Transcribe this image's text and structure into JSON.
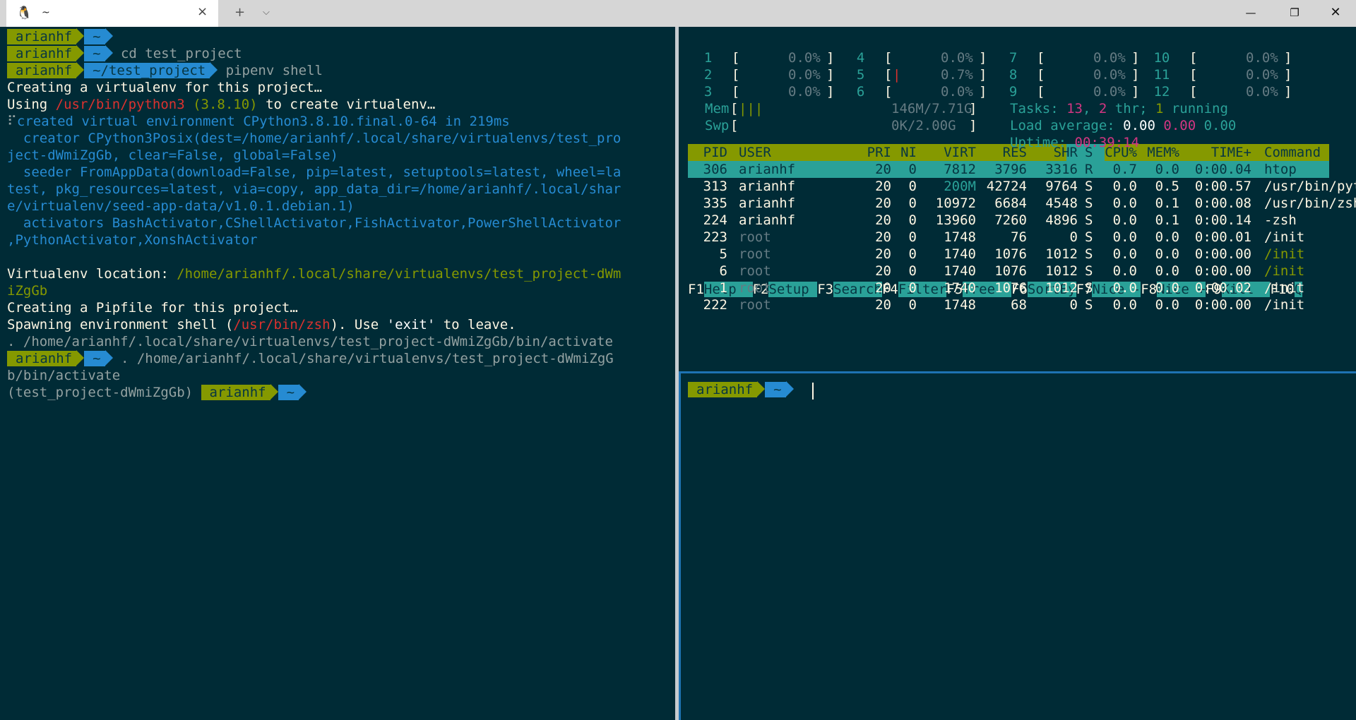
{
  "window": {
    "tab_title": "~",
    "tab_icon": "tux-penguin-icon"
  },
  "left": {
    "lines": [
      {
        "t": "prompt",
        "user": "arianhf",
        "dir": "~",
        "cmd": ""
      },
      {
        "t": "prompt",
        "user": "arianhf",
        "dir": "~",
        "cmd": "cd test_project"
      },
      {
        "t": "prompt",
        "user": "arianhf",
        "dir": "~/test_project",
        "cmd": "pipenv shell"
      },
      {
        "t": "text",
        "segs": [
          [
            "Creating a virtualenv for this project…",
            "wh"
          ]
        ]
      },
      {
        "t": "text",
        "segs": [
          [
            "Using ",
            "wh"
          ],
          [
            "/usr/bin/python3",
            "red"
          ],
          [
            " (3.8.10)",
            "olive"
          ],
          [
            " to create virtualenv…",
            "wh"
          ]
        ]
      },
      {
        "t": "text",
        "segs": [
          [
            "⠏",
            "gray"
          ],
          [
            "created virtual environment CPython3.8.10.final.0-64 in 219ms",
            "blue"
          ]
        ]
      },
      {
        "t": "text",
        "segs": [
          [
            "  creator CPython3Posix(dest=/home/arianhf/.local/share/virtualenvs/test_pro",
            "blue"
          ]
        ]
      },
      {
        "t": "text",
        "segs": [
          [
            "ject-dWmiZgGb, clear=False, global=False)",
            "blue"
          ]
        ]
      },
      {
        "t": "text",
        "segs": [
          [
            "  seeder FromAppData(download=False, pip=latest, setuptools=latest, wheel=la",
            "blue"
          ]
        ]
      },
      {
        "t": "text",
        "segs": [
          [
            "test, pkg_resources=latest, via=copy, app_data_dir=/home/arianhf/.local/shar",
            "blue"
          ]
        ]
      },
      {
        "t": "text",
        "segs": [
          [
            "e/virtualenv/seed-app-data/v1.0.1.debian.1)",
            "blue"
          ]
        ]
      },
      {
        "t": "text",
        "segs": [
          [
            "  activators BashActivator,CShellActivator,FishActivator,PowerShellActivator",
            "blue"
          ]
        ]
      },
      {
        "t": "text",
        "segs": [
          [
            ",PythonActivator,XonshActivator",
            "blue"
          ]
        ]
      },
      {
        "t": "text",
        "segs": [
          [
            "",
            "wh"
          ]
        ]
      },
      {
        "t": "text",
        "segs": [
          [
            "Virtualenv location: ",
            "wh"
          ],
          [
            "/home/arianhf/.local/share/virtualenvs/test_project-dWm",
            "olive"
          ]
        ]
      },
      {
        "t": "text",
        "segs": [
          [
            "iZgGb",
            "olive"
          ]
        ]
      },
      {
        "t": "text",
        "segs": [
          [
            "Creating a Pipfile for this project…",
            "wh"
          ]
        ]
      },
      {
        "t": "text",
        "segs": [
          [
            "Spawning environment shell (",
            "wh"
          ],
          [
            "/usr/bin/zsh",
            "red"
          ],
          [
            "). Use ",
            "wh"
          ],
          [
            "'exit'",
            "bright"
          ],
          [
            " to leave.",
            "wh"
          ]
        ]
      },
      {
        "t": "text",
        "segs": [
          [
            ". /home/arianhf/.local/share/virtualenvs/test_project-dWmiZgGb/bin/activate",
            "gray"
          ]
        ]
      },
      {
        "t": "prompt",
        "user": "arianhf",
        "dir": "~",
        "cmd": ". /home/arianhf/.local/share/virtualenvs/test_project-dWmiZgG"
      },
      {
        "t": "text",
        "segs": [
          [
            "b/bin/activate",
            "gray"
          ]
        ]
      },
      {
        "t": "venvprompt",
        "venv": "(test_project-dWmiZgGb)",
        "user": "arianhf",
        "dir": "~"
      }
    ]
  },
  "htop": {
    "cpus": [
      {
        "n": "1",
        "bar": "",
        "pct": "0.0%"
      },
      {
        "n": "2",
        "bar": "",
        "pct": "0.0%"
      },
      {
        "n": "3",
        "bar": "",
        "pct": "0.0%"
      },
      {
        "n": "4",
        "bar": "",
        "pct": "0.0%"
      },
      {
        "n": "5",
        "bar": "|",
        "pct": "0.7%"
      },
      {
        "n": "6",
        "bar": "",
        "pct": "0.0%"
      },
      {
        "n": "7",
        "bar": "",
        "pct": "0.0%"
      },
      {
        "n": "8",
        "bar": "",
        "pct": "0.0%"
      },
      {
        "n": "9",
        "bar": "",
        "pct": "0.0%"
      },
      {
        "n": "10",
        "bar": "",
        "pct": "0.0%"
      },
      {
        "n": "11",
        "bar": "",
        "pct": "0.0%"
      },
      {
        "n": "12",
        "bar": "",
        "pct": "0.0%"
      }
    ],
    "mem": {
      "label": "Mem",
      "bar": "|||",
      "value": "146M/7.71G"
    },
    "swp": {
      "label": "Swp",
      "bar": "",
      "value": "0K/2.00G"
    },
    "tasks": {
      "label": "Tasks: ",
      "count": "13",
      "sep1": ", ",
      "thr": "2",
      "thr_label": " thr; ",
      "running": "1",
      "running_label": " running"
    },
    "load": {
      "label": "Load average: ",
      "v1": "0.00",
      "v2": "0.00",
      "v3": "0.00"
    },
    "uptime": {
      "label": "Uptime: ",
      "value": "00:39:14"
    },
    "columns": [
      "PID",
      "USER",
      "PRI",
      "NI",
      "VIRT",
      "RES",
      "SHR",
      "S",
      "CPU%",
      "MEM%",
      "TIME+",
      "Command"
    ],
    "processes": [
      [
        "306",
        "arianhf",
        "20",
        "0",
        "7812",
        "3796",
        "3316",
        "R",
        "0.7",
        "0.0",
        "0:00.04",
        "htop"
      ],
      [
        "313",
        "arianhf",
        "20",
        "0",
        "200M",
        "42724",
        "9764",
        "S",
        "0.0",
        "0.5",
        "0:00.57",
        "/usr/bin/pyth"
      ],
      [
        "335",
        "arianhf",
        "20",
        "0",
        "10972",
        "6684",
        "4548",
        "S",
        "0.0",
        "0.1",
        "0:00.08",
        "/usr/bin/zsh"
      ],
      [
        "224",
        "arianhf",
        "20",
        "0",
        "13960",
        "7260",
        "4896",
        "S",
        "0.0",
        "0.1",
        "0:00.14",
        "-zsh"
      ],
      [
        "223",
        "root",
        "20",
        "0",
        "1748",
        "76",
        "0",
        "S",
        "0.0",
        "0.0",
        "0:00.01",
        "/init"
      ],
      [
        "5",
        "root",
        "20",
        "0",
        "1740",
        "1076",
        "1012",
        "S",
        "0.0",
        "0.0",
        "0:00.00",
        "/init"
      ],
      [
        "6",
        "root",
        "20",
        "0",
        "1740",
        "1076",
        "1012",
        "S",
        "0.0",
        "0.0",
        "0:00.00",
        "/init"
      ],
      [
        "1",
        "root",
        "20",
        "0",
        "1740",
        "1076",
        "1012",
        "S",
        "0.0",
        "0.0",
        "0:00.02",
        "/init"
      ],
      [
        "222",
        "root",
        "20",
        "0",
        "1748",
        "68",
        "0",
        "S",
        "0.0",
        "0.0",
        "0:00.00",
        "/init"
      ]
    ],
    "fkeys": [
      [
        "F1",
        "Help  "
      ],
      [
        "F2",
        "Setup "
      ],
      [
        "F3",
        "Search"
      ],
      [
        "F4",
        "Filter"
      ],
      [
        "F5",
        "Tree  "
      ],
      [
        "F6",
        "SortBy"
      ],
      [
        "F7",
        "Nice -"
      ],
      [
        "F8",
        "Nice +"
      ],
      [
        "F9",
        "Kill  "
      ],
      [
        "F10",
        "Q"
      ]
    ]
  },
  "bottom": {
    "user": "arianhf",
    "dir": "~"
  },
  "colors": {
    "bg": "#002b36",
    "green": "#859900",
    "blue": "#268bd2",
    "cyan": "#2aa198",
    "red": "#dc322f",
    "magenta": "#d33682"
  }
}
